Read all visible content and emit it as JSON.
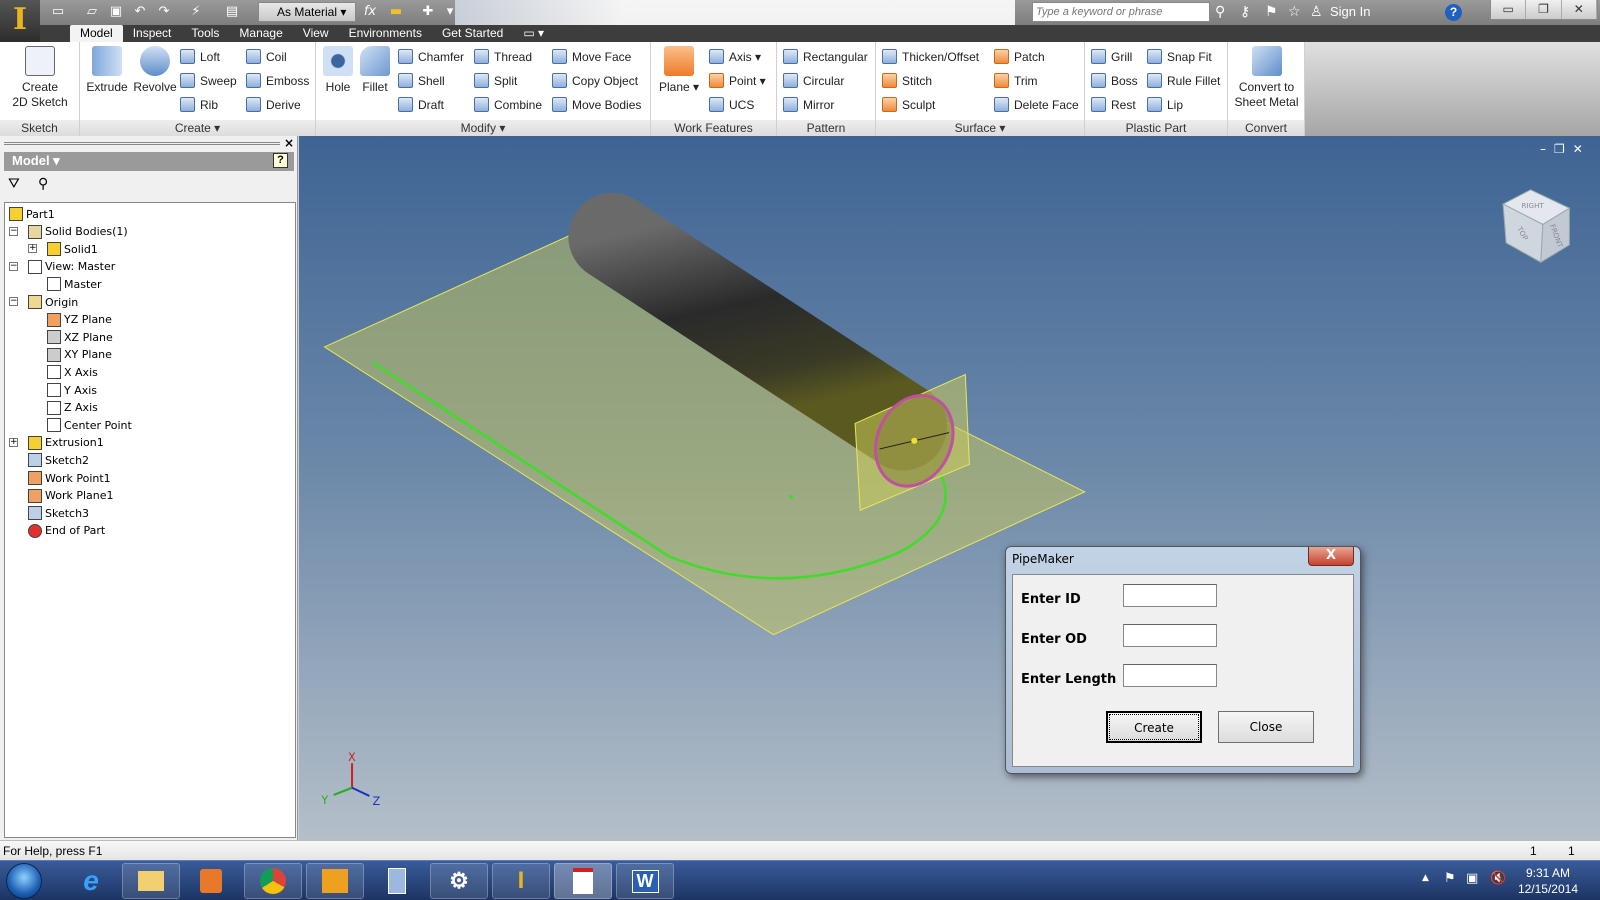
{
  "app": {
    "logo_letter": "I",
    "material": "As Material",
    "search_placeholder": "Type a keyword or phrase",
    "sign_in": "Sign In",
    "help": "?"
  },
  "tabs": [
    "Model",
    "Inspect",
    "Tools",
    "Manage",
    "View",
    "Environments",
    "Get Started"
  ],
  "ribbon": {
    "sketch": {
      "label": "Sketch",
      "create_2d": "Create\n2D Sketch"
    },
    "create": {
      "label": "Create ▾",
      "extrude": "Extrude",
      "revolve": "Revolve",
      "items": [
        "Loft",
        "Sweep",
        "Rib",
        "Coil",
        "Emboss",
        "Derive"
      ]
    },
    "modify": {
      "label": "Modify ▾",
      "hole": "Hole",
      "fillet": "Fillet",
      "items": [
        "Chamfer",
        "Shell",
        "Draft",
        "Thread",
        "Split",
        "Combine",
        "Move Face",
        "Copy Object",
        "Move Bodies"
      ]
    },
    "work": {
      "label": "Work Features",
      "plane": "Plane",
      "items": [
        "Axis ▾",
        "Point ▾",
        "UCS"
      ]
    },
    "pattern": {
      "label": "Pattern",
      "items": [
        "Rectangular",
        "Circular",
        "Mirror"
      ]
    },
    "surface": {
      "label": "Surface ▾",
      "items": [
        "Thicken/Offset",
        "Stitch",
        "Sculpt",
        "Patch",
        "Trim",
        "Delete Face"
      ]
    },
    "plastic": {
      "label": "Plastic Part",
      "items": [
        "Grill",
        "Boss",
        "Rest",
        "Snap Fit",
        "Rule Fillet",
        "Lip"
      ]
    },
    "convert": {
      "label": "Convert",
      "btn": "Convert to\nSheet Metal"
    }
  },
  "browser": {
    "title": "Model ▾",
    "close": "×",
    "tree": [
      {
        "label": "Part1",
        "icon": "part-icon"
      },
      {
        "label": "Solid Bodies(1)",
        "icon": "solid-bodies-folder-icon"
      },
      {
        "label": "Solid1",
        "icon": "solid-icon"
      },
      {
        "label": "View: Master",
        "icon": "view-rep-icon"
      },
      {
        "label": "Master",
        "icon": "checkbox-lock-icon"
      },
      {
        "label": "Origin",
        "icon": "folder-icon"
      },
      {
        "label": "YZ Plane",
        "icon": "plane-icon"
      },
      {
        "label": "XZ Plane",
        "icon": "plane-icon"
      },
      {
        "label": "XY Plane",
        "icon": "plane-icon"
      },
      {
        "label": "X Axis",
        "icon": "axis-icon"
      },
      {
        "label": "Y Axis",
        "icon": "axis-icon"
      },
      {
        "label": "Z Axis",
        "icon": "axis-icon"
      },
      {
        "label": "Center Point",
        "icon": "center-point-icon"
      },
      {
        "label": "Extrusion1",
        "icon": "extrusion-icon"
      },
      {
        "label": "Sketch2",
        "icon": "sketch-icon"
      },
      {
        "label": "Work Point1",
        "icon": "work-point-icon"
      },
      {
        "label": "Work Plane1",
        "icon": "work-plane-icon"
      },
      {
        "label": "Sketch3",
        "icon": "sketch-icon"
      },
      {
        "label": "End of Part",
        "icon": "end-of-part-icon"
      }
    ]
  },
  "viewcube": {
    "top": "TOP",
    "front": "FRONT",
    "right": "RIGHT"
  },
  "triad": {
    "x": "X",
    "y": "Y",
    "z": "Z"
  },
  "dialog": {
    "title": "PipeMaker",
    "close": "X",
    "fields": [
      {
        "label": "Enter ID",
        "value": ""
      },
      {
        "label": "Enter OD",
        "value": ""
      },
      {
        "label": "Enter Length",
        "value": ""
      }
    ],
    "create": "Create",
    "cancel": "Close"
  },
  "status": {
    "help": "For Help, press F1",
    "count1": "1",
    "count2": "1"
  },
  "taskbar": {
    "apps": [
      "internet-explorer",
      "file-explorer",
      "media-player",
      "chrome",
      "outlook",
      "calculator",
      "settings-tool",
      "inventor",
      "vba-editor",
      "word"
    ],
    "ie": "e",
    "word": "W",
    "time": "9:31 AM",
    "date": "12/15/2014"
  },
  "colors": {
    "accent_plane": "#c8c85a",
    "sketch_green": "#3fdc2a",
    "profile_magenta": "#c050a0"
  }
}
